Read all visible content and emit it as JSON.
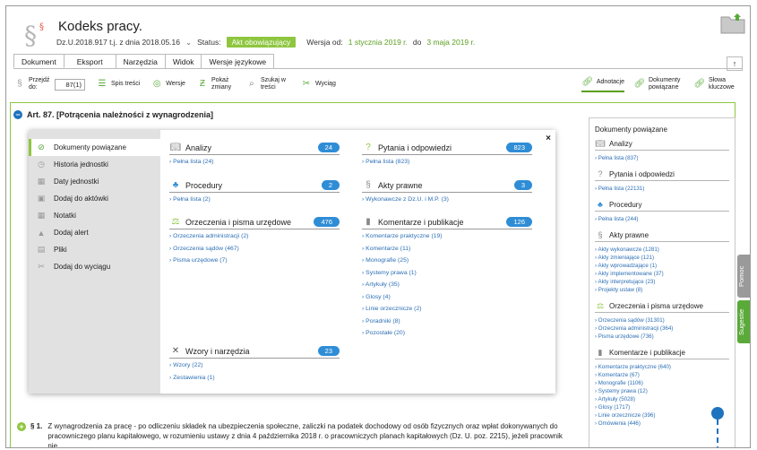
{
  "doc": {
    "title": "Kodeks pracy.",
    "ref": "Dz.U.2018.917 t.j. z dnia 2018.05.16",
    "status_label": "Status:",
    "status_badge": "Akt obowiązujący",
    "version_label": "Wersja od:",
    "version_from": "1 stycznia 2019 r.",
    "version_to_label": "do",
    "version_to": "3 maja 2019 r."
  },
  "tabs": [
    "Dokument",
    "Eksport",
    "Narzędzia",
    "Widok",
    "Wersje językowe"
  ],
  "toolbar": {
    "goto_label": "Przejdź do:",
    "goto_value": "87(1)",
    "toc": "Spis treści",
    "versions": "Wersje",
    "show_changes": "Pokaż zmiany",
    "search_in": "Szukaj w treści",
    "excerpt": "Wyciąg",
    "annotations": "Adnotacje",
    "related_docs": "Dokumenty powiązane",
    "keywords": "Słowa kluczowe"
  },
  "article": {
    "heading": "Art. 87. [Potrącenia należności z wynagrodzenia]",
    "para_num": "§ 1.",
    "para_text": "Z wynagrodzenia za pracę - po odliczeniu składek na ubezpieczenia społeczne, zaliczki na podatek dochodowy od osób fizycznych oraz wpłat dokonywanych do pracowniczego planu kapitałowego, w rozumieniu ustawy z dnia 4 października 2018 r. o pracowniczych planach kapitałowych (Dz. U. poz. 2215), jeżeli pracownik nie"
  },
  "popup": {
    "menu": [
      {
        "label": "Dokumenty powiązane",
        "icon": "link-icon"
      },
      {
        "label": "Historia jednostki",
        "icon": "clock-icon"
      },
      {
        "label": "Daty jednostki",
        "icon": "calendar-icon"
      },
      {
        "label": "Dodaj do aktówki",
        "icon": "briefcase-icon"
      },
      {
        "label": "Notatki",
        "icon": "calendar-icon"
      },
      {
        "label": "Dodaj alert",
        "icon": "bell-icon"
      },
      {
        "label": "Pliki",
        "icon": "file-icon"
      },
      {
        "label": "Dodaj do wyciągu",
        "icon": "excerpt-icon"
      }
    ],
    "sections": {
      "analizy": {
        "title": "Analizy",
        "count": "24",
        "links": [
          "Pełna lista (24)"
        ]
      },
      "pytania": {
        "title": "Pytania i odpowiedzi",
        "count": "823",
        "links": [
          "Pełna lista (823)"
        ]
      },
      "procedury": {
        "title": "Procedury",
        "count": "2",
        "links": [
          "Pełna lista (2)"
        ]
      },
      "akty": {
        "title": "Akty prawne",
        "count": "3",
        "links": [
          "Wykonawcze z Dz.U. i M.P. (3)"
        ]
      },
      "orzeczenia": {
        "title": "Orzeczenia i pisma urzędowe",
        "count": "476",
        "links": [
          "Orzeczenia administracji (2)",
          "Orzeczenia sądów (467)",
          "Pisma urzędowe (7)"
        ]
      },
      "komentarze": {
        "title": "Komentarze i publikacje",
        "count": "126",
        "links": [
          "Komentarze praktyczne (19)",
          "Komentarze (11)",
          "Monografie (25)",
          "Systemy prawa (1)",
          "Artykuły (35)",
          "Glosy (4)",
          "Linie orzecznicze (2)",
          "Poradniki (8)",
          "Pozostałe (20)"
        ]
      },
      "wzory": {
        "title": "Wzory i narzędzia",
        "count": "23",
        "links": [
          "Wzory (22)",
          "Zestawienia (1)"
        ]
      }
    }
  },
  "rpanel": {
    "title": "Dokumenty powiązane",
    "sections": [
      {
        "title": "Analizy",
        "icon": "book-icon",
        "links": [
          "Pełna lista (837)"
        ]
      },
      {
        "title": "Pytania i odpowiedzi",
        "icon": "question-icon",
        "links": [
          "Pełna lista (22131)"
        ]
      },
      {
        "title": "Procedury",
        "icon": "procedure-icon",
        "links": [
          "Pełna lista (244)"
        ]
      },
      {
        "title": "Akty prawne",
        "icon": "section-icon",
        "links": [
          "Akty wykonawcze (1281)",
          "Akty zmieniające (121)",
          "Akty wprowadzające (1)",
          "Akty implementowane (37)",
          "Akty interpretujące (23)",
          "Projekty ustaw (8)"
        ]
      },
      {
        "title": "Orzeczenia i pisma urzędowe",
        "icon": "scales-icon",
        "links": [
          "Orzeczenia sądów (31301)",
          "Orzeczenia administracji (364)",
          "Pisma urzędowe (736)"
        ]
      },
      {
        "title": "Komentarze i publikacje",
        "icon": "book-icon",
        "links": [
          "Komentarze praktyczne (640)",
          "Komentarze (67)",
          "Monografie (1106)",
          "Systemy prawa (12)",
          "Artykuły (5028)",
          "Glosy (1717)",
          "Linie orzecznicze (396)",
          "Omówienia (446)"
        ]
      }
    ]
  },
  "side_tabs": {
    "help": "Pomoc",
    "suggest": "Sugestie"
  },
  "colors": {
    "accent_green": "#8ec63f",
    "accent_blue": "#2f8dd6",
    "link_blue": "#2d6fb5"
  }
}
